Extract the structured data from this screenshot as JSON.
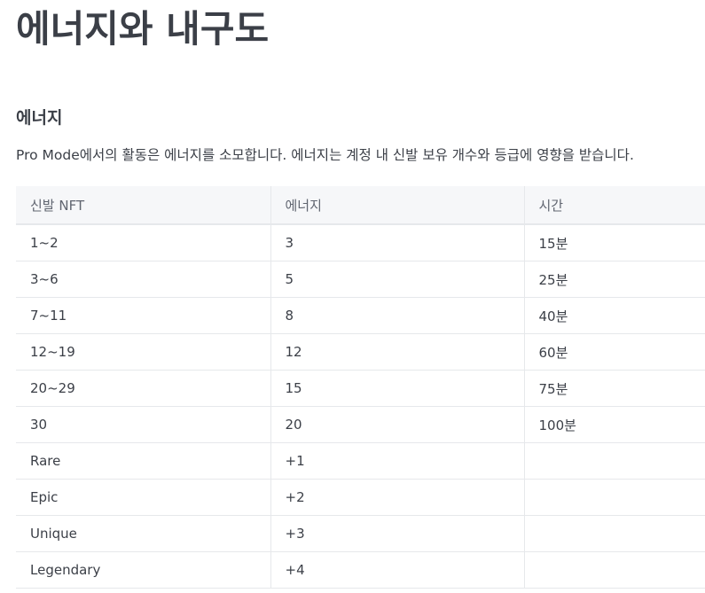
{
  "page": {
    "title": "에너지와 내구도"
  },
  "section": {
    "heading": "에너지",
    "description": "Pro Mode에서의 활동은 에너지를 소모합니다. 에너지는 계정 내 신발 보유 개수와 등급에 영향을 받습니다."
  },
  "table": {
    "headers": [
      "신발 NFT",
      "에너지",
      "시간"
    ],
    "rows": [
      [
        "1~2",
        "3",
        "15분"
      ],
      [
        "3~6",
        "5",
        "25분"
      ],
      [
        "7~11",
        "8",
        "40분"
      ],
      [
        "12~19",
        "12",
        "60분"
      ],
      [
        "20~29",
        "15",
        "75분"
      ],
      [
        "30",
        "20",
        "100분"
      ],
      [
        "Rare",
        "+1",
        ""
      ],
      [
        "Epic",
        "+2",
        ""
      ],
      [
        "Unique",
        "+3",
        ""
      ],
      [
        "Legendary",
        "+4",
        ""
      ]
    ]
  }
}
